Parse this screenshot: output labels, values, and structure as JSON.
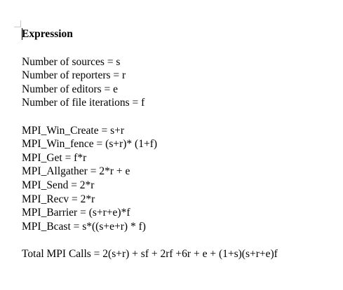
{
  "document": {
    "heading": "Expression",
    "variables": [
      "Number of sources = s",
      "Number of reporters = r",
      "Number of editors = e",
      "Number of file iterations = f"
    ],
    "calls": [
      "MPI_Win_Create = s+r",
      "MPI_Win_fence = (s+r)* (1+f)",
      "MPI_Get = f*r",
      "MPI_Allgather = 2*r + e",
      "MPI_Send = 2*r",
      "MPI_Recv = 2*r",
      "MPI_Barrier = (s+r+e)*f",
      "MPI_Bcast = s*((s+e+r) * f)"
    ],
    "total": "Total MPI Calls = 2(s+r) + sf + 2rf +6r + e + (1+s)(s+r+e)f"
  },
  "colors": {
    "text": "#000000",
    "background": "#ffffff",
    "margin_mark": "#c8c8c8"
  }
}
